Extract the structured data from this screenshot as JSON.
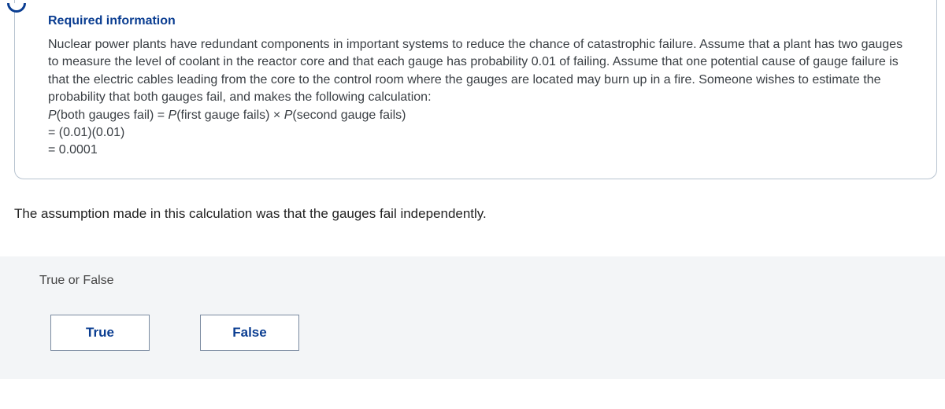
{
  "info": {
    "title": "Required information",
    "paragraph": "Nuclear power plants have redundant components in important systems to reduce the chance of catastrophic failure. Assume that a plant has two gauges to measure the level of coolant in the reactor core and that each gauge has probability 0.01 of failing. Assume that one potential cause of gauge failure is that the electric cables leading from the core to the control room where the gauges are located may burn up in a fire. Someone wishes to estimate the probability that both gauges fail, and makes the following calculation:",
    "eq_line1_a": "P",
    "eq_line1_b": "(both gauges fail) = ",
    "eq_line1_c": "P",
    "eq_line1_d": "(first gauge fails) × ",
    "eq_line1_e": "P",
    "eq_line1_f": "(second gauge fails)",
    "eq_line2": "= (0.01)(0.01)",
    "eq_line3": "= 0.0001"
  },
  "statement": "The assumption made in this calculation was that the gauges fail independently.",
  "answer": {
    "prompt": "True or False",
    "true_label": "True",
    "false_label": "False"
  }
}
